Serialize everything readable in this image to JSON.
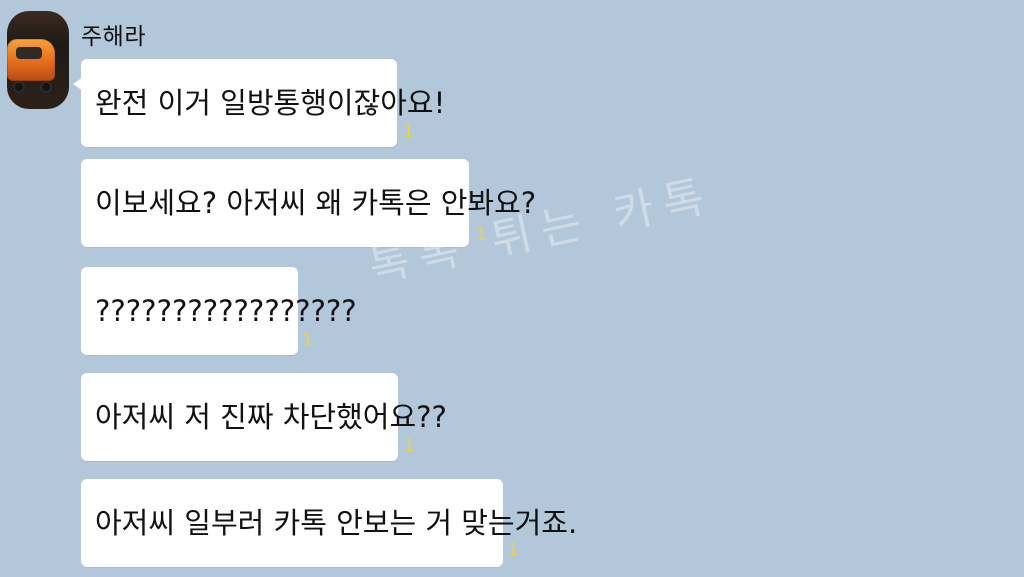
{
  "chat": {
    "sender_name": "주해라",
    "messages": [
      {
        "text": "완전 이거 일방통행이잖아요!",
        "unread": "1"
      },
      {
        "text": "이보세요? 아저씨 왜 카톡은 안봐요?",
        "unread": "1"
      },
      {
        "text": "?????????????????",
        "unread": "1"
      },
      {
        "text": "아저씨 저 진짜 차단했어요??",
        "unread": "1"
      },
      {
        "text": "아저씨 일부러 카톡 안보는 거 맞는거죠.",
        "unread": "1"
      }
    ]
  },
  "watermark": {
    "text": "톡톡 튀는 카톡"
  },
  "icons": {
    "avatar": "taxi-photo"
  }
}
